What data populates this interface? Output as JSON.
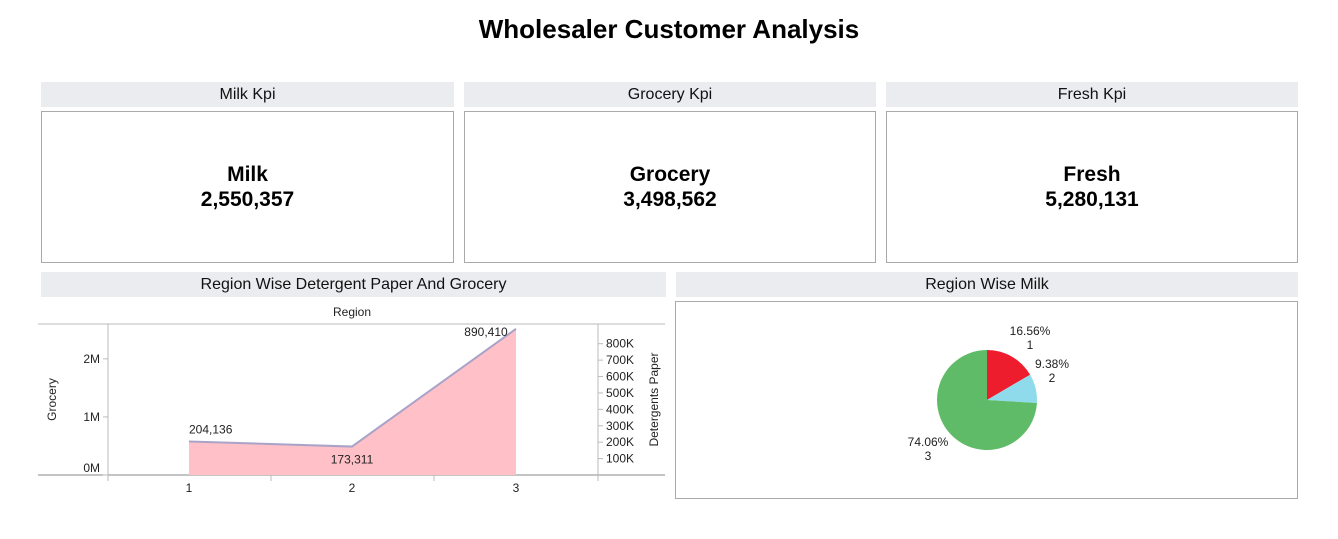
{
  "dashboard": {
    "title": "Wholesaler Customer Analysis"
  },
  "kpis": [
    {
      "header": "Milk Kpi",
      "label": "Milk",
      "value": "2,550,357"
    },
    {
      "header": "Grocery Kpi",
      "label": "Grocery",
      "value": "3,498,562"
    },
    {
      "header": "Fresh Kpi",
      "label": "Fresh",
      "value": "5,280,131"
    }
  ],
  "area_panel": {
    "header": "Region Wise Detergent Paper And Grocery"
  },
  "pie_panel": {
    "header": "Region Wise Milk"
  },
  "colors": {
    "grocery_area": "#4e79a7",
    "detergents_area": "#ffc0c8",
    "pie_region_1": "#ee1d2d",
    "pie_region_2": "#90dbeb",
    "pie_region_3": "#5fbb68"
  },
  "chart_data": [
    {
      "type": "area",
      "title": "",
      "x_axis_title": "Region",
      "xlabel": "Region",
      "categories": [
        "1",
        "2",
        "3"
      ],
      "y_left": {
        "label": "Grocery",
        "ticks": [
          "0M",
          "1M",
          "2M"
        ],
        "tick_values": [
          0,
          1000000,
          2000000
        ],
        "range": [
          0,
          2600000
        ]
      },
      "y_right": {
        "label": "Detergents Paper",
        "ticks": [
          "100K",
          "200K",
          "300K",
          "400K",
          "500K",
          "600K",
          "700K",
          "800K"
        ],
        "tick_values": [
          100000,
          200000,
          300000,
          400000,
          500000,
          600000,
          700000,
          800000
        ],
        "range": [
          0,
          920000
        ]
      },
      "series": [
        {
          "name": "Grocery",
          "axis": "left",
          "values": [
            570037,
            433274,
            2495251
          ]
        },
        {
          "name": "Detergents Paper",
          "axis": "right",
          "values": [
            204136,
            173311,
            890410
          ],
          "labels": [
            "204,136",
            "173,311",
            "890,410"
          ]
        }
      ]
    },
    {
      "type": "pie",
      "title": "",
      "categories": [
        "1",
        "2",
        "3"
      ],
      "values": [
        16.56,
        9.38,
        74.06
      ],
      "labels": [
        "16.56%",
        "9.38%",
        "74.06%"
      ]
    }
  ]
}
